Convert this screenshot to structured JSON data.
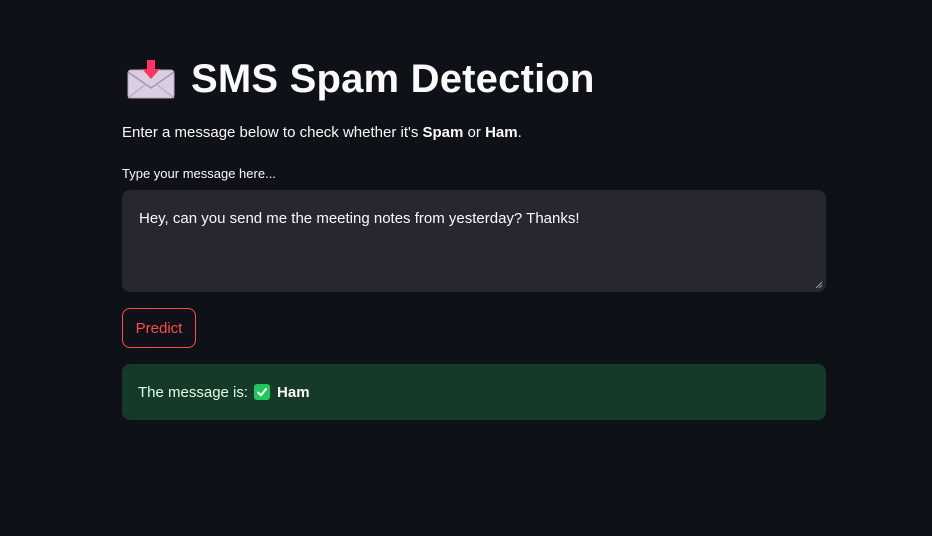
{
  "header": {
    "icon": "incoming-envelope-icon",
    "title": "SMS Spam Detection"
  },
  "intro": {
    "prefix": "Enter a message below to check whether it's ",
    "spam": "Spam",
    "middle": " or ",
    "ham": "Ham",
    "suffix": "."
  },
  "input": {
    "label": "Type your message here...",
    "value": "Hey, can you send me the meeting notes from yesterday? Thanks!"
  },
  "actions": {
    "predict_label": "Predict"
  },
  "result": {
    "prefix": "The message is:",
    "icon": "check-mark-icon",
    "label": "Ham"
  },
  "colors": {
    "background": "#0e1117",
    "input_bg": "#262730",
    "accent": "#ff4b4b",
    "success_bg": "#173928",
    "success_icon": "#22c55e"
  }
}
